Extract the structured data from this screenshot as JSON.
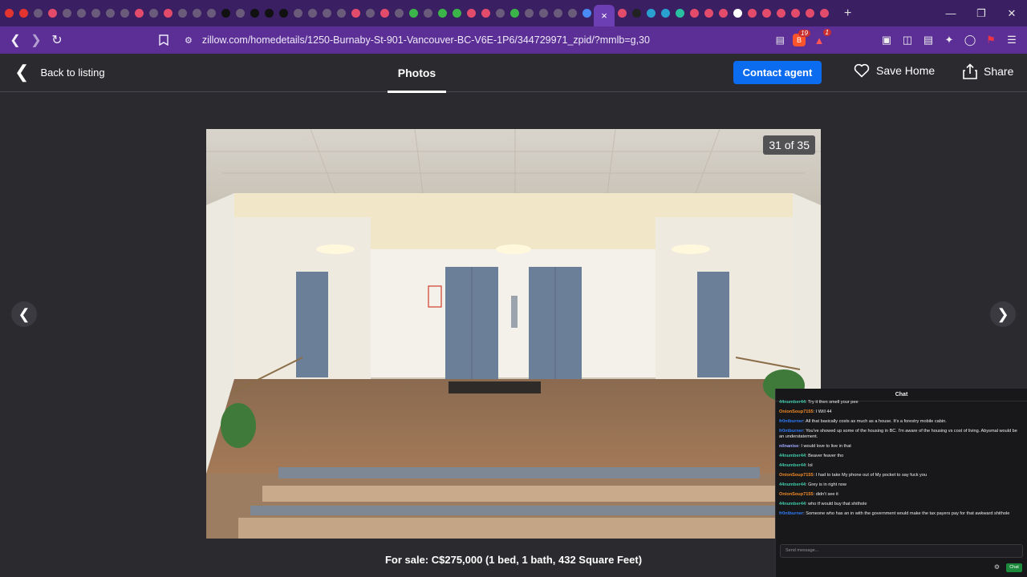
{
  "browser": {
    "tab_favicon_colors": [
      "#e3342f",
      "#e3342f",
      "#6b5b7b",
      "#e34b6b",
      "#6b5b7b",
      "#6b5b7b",
      "#6b5b7b",
      "#6b5b7b",
      "#6b5b7b",
      "#e34b6b",
      "#6b5b7b",
      "#e34b6b",
      "#6b5b7b",
      "#6b5b7b",
      "#6b5b7b",
      "#111111",
      "#6b5b7b",
      "#111111",
      "#111111",
      "#111111",
      "#6b5b7b",
      "#6b5b7b",
      "#6b5b7b",
      "#6b5b7b",
      "#e34b6b",
      "#6b5b7b",
      "#e34b6b",
      "#6b5b7b",
      "#3bb54a",
      "#6b5b7b",
      "#3bb54a",
      "#3bb54a",
      "#e34b6b",
      "#e34b6b",
      "#6b5b7b",
      "#3bb54a",
      "#6b5b7b",
      "#6b5b7b",
      "#6b5b7b",
      "#6b5b7b",
      "#4a8af4"
    ],
    "tab_favicon_colors_after": [
      "#e34b6b",
      "#222222",
      "#29a0d0",
      "#29a0d0",
      "#29c0a0",
      "#e34b6b",
      "#e34b6b",
      "#e34b6b",
      "#ffffff",
      "#e34b6b",
      "#e34b6b",
      "#e34b6b",
      "#e34b6b",
      "#e34b6b",
      "#e34b6b"
    ],
    "active_tab_icon": "×",
    "new_tab": "+",
    "url": "zillow.com/homedetails/1250-Burnaby-St-901-Vancouver-BC-V6E-1P6/344729971_zpid/?mmlb=g,30",
    "brave_badge": "19",
    "alert_badge": "1"
  },
  "header": {
    "back_label": "Back to listing",
    "photos_tab": "Photos",
    "contact_label": "Contact agent",
    "save_label": "Save Home",
    "share_label": "Share"
  },
  "photo": {
    "counter": "31 of 35",
    "current": 31,
    "total": 35
  },
  "caption": "For sale: C$275,000 (1 bed, 1 bath, 432 Square Feet)",
  "chat": {
    "title": "Chat",
    "messages": [
      {
        "user": "44number44",
        "color": "#3fc9a7",
        "text": "Try it then smell your pee"
      },
      {
        "user": "OnionSoup7155",
        "color": "#f08a24",
        "text": "I Will 44"
      },
      {
        "user": "fr0ntburner",
        "color": "#2f7bf5",
        "text": "All that basically costs as much as a house. It's a forestry mobile cabin."
      },
      {
        "user": "fr0ntburner",
        "color": "#2f7bf5",
        "text": "You've showed up some of the housing in BC. I'm aware of the housing vs cost of living. Abysmal would be an understatement."
      },
      {
        "user": "nilnanise",
        "color": "#9fa8ff",
        "text": "I would love to live in that"
      },
      {
        "user": "44number44",
        "color": "#3fc9a7",
        "text": "Beaver feaver tho"
      },
      {
        "user": "44number44",
        "color": "#3fc9a7",
        "text": "lol"
      },
      {
        "user": "OnionSoup7155",
        "color": "#f08a24",
        "text": "I had to take My phone out of My pocket to say fuck you"
      },
      {
        "user": "44number44",
        "color": "#3fc9a7",
        "text": "Grey is in right now"
      },
      {
        "user": "OnionSoup7155",
        "color": "#f08a24",
        "text": "didn't see it"
      },
      {
        "user": "44number44",
        "color": "#3fc9a7",
        "text": "who tf would buy that shithole"
      },
      {
        "user": "fr0ntburner",
        "color": "#2f7bf5",
        "text": "Someone who has an in with the government would make the tax payers pay for that awkward shithole"
      }
    ],
    "input_placeholder": "Send message...",
    "send_label": "Chat"
  }
}
